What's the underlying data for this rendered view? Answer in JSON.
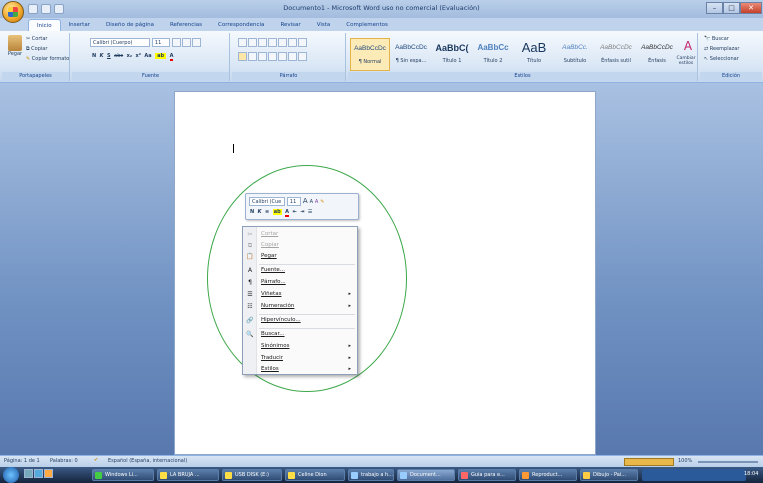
{
  "window": {
    "title": "Documento1 - Microsoft Word uso no comercial (Evaluación)",
    "minimize": "–",
    "maximize": "□",
    "close": "✕"
  },
  "tabs": [
    "Inicio",
    "Insertar",
    "Diseño de página",
    "Referencias",
    "Correspondencia",
    "Revisar",
    "Vista",
    "Complementos"
  ],
  "ribbon": {
    "clipboard": {
      "paste": "Pegar",
      "cut": "Cortar",
      "copy": "Copiar",
      "format_painter": "Copiar formato",
      "label": "Portapapeles"
    },
    "font": {
      "name": "Calibri (Cuerpo)",
      "size": "11",
      "bold": "N",
      "italic": "K",
      "underline": "S",
      "strike": "abc",
      "sub": "x₂",
      "sup": "x²",
      "case": "Aa",
      "label": "Fuente"
    },
    "paragraph": {
      "label": "Párrafo"
    },
    "styles": {
      "items": [
        {
          "sample": "AaBbCcDc",
          "name": "¶ Normal"
        },
        {
          "sample": "AaBbCcDc",
          "name": "¶ Sin espa..."
        },
        {
          "sample": "AaBbC(",
          "name": "Título 1"
        },
        {
          "sample": "AaBbCc",
          "name": "Título 2"
        },
        {
          "sample": "AaB",
          "name": "Título"
        },
        {
          "sample": "AaBbCc.",
          "name": "Subtítulo"
        },
        {
          "sample": "AaBbCcDc",
          "name": "Énfasis sutil"
        },
        {
          "sample": "AaBbCcDc",
          "name": "Énfasis"
        }
      ],
      "change": "Cambiar estilos",
      "label": "Estilos"
    },
    "edit": {
      "find": "Buscar",
      "replace": "Reemplazar",
      "select": "Seleccionar",
      "label": "Edición"
    }
  },
  "mini_toolbar": {
    "font": "Calibri (Cue",
    "size": "11",
    "bold": "N",
    "italic": "K",
    "grow": "A",
    "shrink": "A"
  },
  "context_menu": [
    {
      "label": "Cortar",
      "icon": "✂",
      "disabled": true,
      "submenu": false
    },
    {
      "label": "Copiar",
      "icon": "⧉",
      "disabled": true,
      "submenu": false
    },
    {
      "label": "Pegar",
      "icon": "📋",
      "disabled": false,
      "submenu": false
    },
    {
      "label": "Fuente...",
      "icon": "A",
      "disabled": false,
      "submenu": false
    },
    {
      "label": "Párrafo...",
      "icon": "¶",
      "disabled": false,
      "submenu": false
    },
    {
      "label": "Viñetas",
      "icon": "☰",
      "disabled": false,
      "submenu": true
    },
    {
      "label": "Numeración",
      "icon": "☷",
      "disabled": false,
      "submenu": true
    },
    {
      "label": "Hipervínculo...",
      "icon": "🔗",
      "disabled": false,
      "submenu": false
    },
    {
      "label": "Buscar...",
      "icon": "🔍",
      "disabled": false,
      "submenu": false
    },
    {
      "label": "Sinónimos",
      "icon": "",
      "disabled": false,
      "submenu": true
    },
    {
      "label": "Traducir",
      "icon": "",
      "disabled": false,
      "submenu": true
    },
    {
      "label": "Estilos",
      "icon": "",
      "disabled": false,
      "submenu": true
    }
  ],
  "statusbar": {
    "page": "Página: 1 de 1",
    "words": "Palabras: 0",
    "language": "Español (España, internacional)",
    "zoom": "100%"
  },
  "taskbar": {
    "items": [
      "Windows Li...",
      "LA BRUJA ...",
      "USB DISK (E:)",
      "Celine Dion",
      "trabajo a h...",
      "Document...",
      "Guia para e...",
      "Reproduct...",
      "Dibujo - Pai..."
    ],
    "clock": "18:04"
  },
  "colors": {
    "ribbon_blue": "#15428b",
    "ellipse_green": "#3da84a",
    "workspace": "#6f91c2"
  }
}
